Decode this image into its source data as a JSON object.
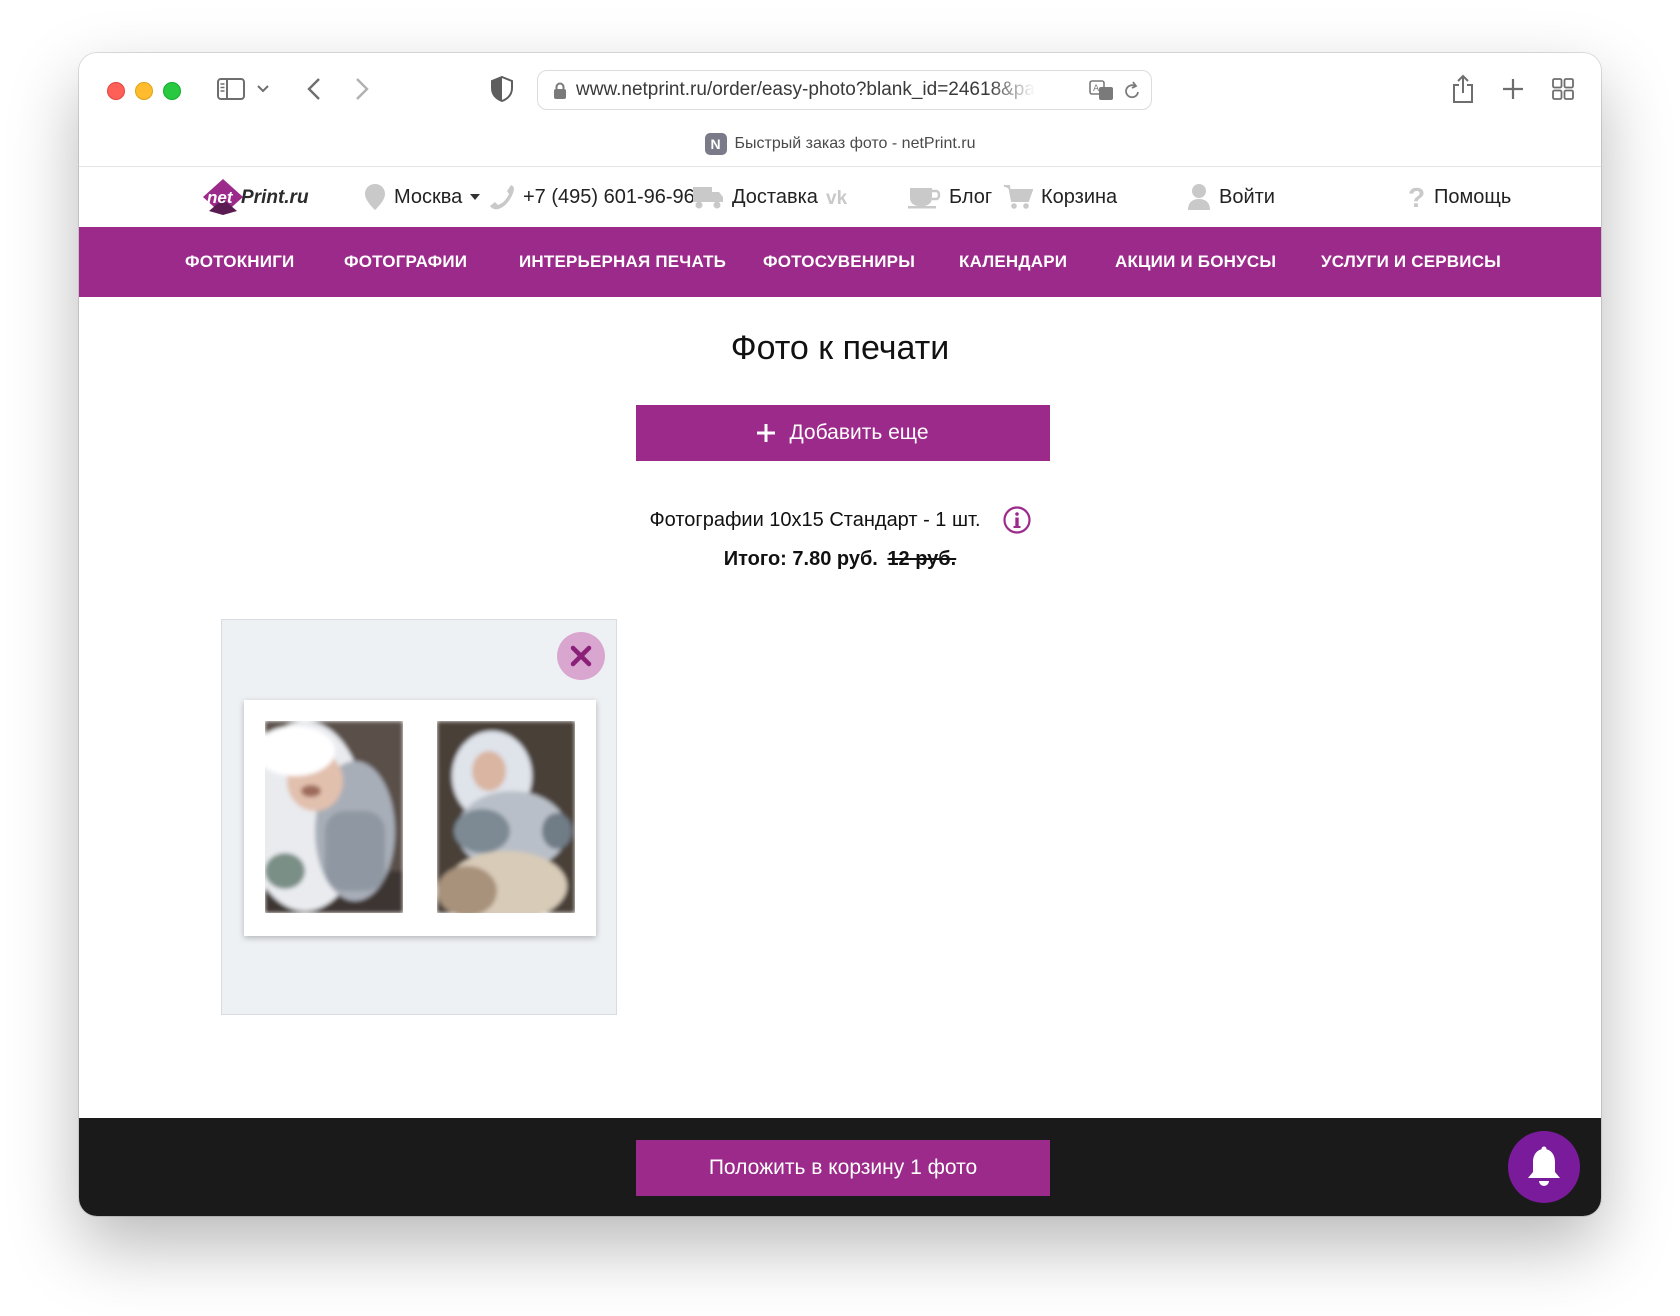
{
  "browser": {
    "url": "www.netprint.ru/order/easy-photo?blank_id=24618&pa",
    "tab_title": "Быстрый заказ фото - netPrint.ru",
    "favicon_letter": "N"
  },
  "header": {
    "logo_text": "net Print.ru",
    "city": "Москва",
    "phone": "+7 (495) 601-96-96",
    "delivery": "Доставка",
    "blog": "Блог",
    "cart": "Корзина",
    "login": "Войти",
    "help": "Помощь"
  },
  "nav": {
    "items": [
      "ФОТОКНИГИ",
      "ФОТОГРАФИИ",
      "ИНТЕРЬЕРНАЯ ПЕЧАТЬ",
      "ФОТОСУВЕНИРЫ",
      "КАЛЕНДАРИ",
      "АКЦИИ И БОНУСЫ",
      "УСЛУГИ И СЕРВИСЫ"
    ]
  },
  "main": {
    "title": "Фото к печати",
    "add_more": "Добавить еще",
    "product_line": "Фотографии 10x15 Стандарт - 1 шт.",
    "total_label": "Итого: 7.80 руб.",
    "old_price": "12 руб."
  },
  "footer": {
    "cart_button": "Положить в корзину 1 фото"
  },
  "colors": {
    "brand": "#9c2a8a",
    "bar_dark": "#1b1a1b",
    "bell": "#7a1b9c"
  }
}
